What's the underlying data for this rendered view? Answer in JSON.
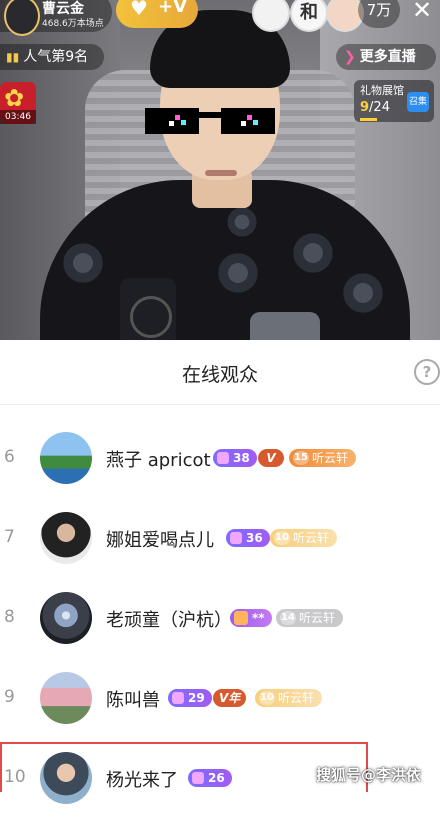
{
  "stream": {
    "host_name": "曹云金",
    "host_sub": "468.6万本场点",
    "follow_label": "+V",
    "viewer_avatar_labels": [
      "",
      "和",
      ""
    ],
    "viewer_count": "7万",
    "popularity_rank": "人气第9名",
    "more_live": "更多直播",
    "gift_timer": "03:46",
    "gift_gallery": {
      "title": "礼物展馆",
      "current": "9",
      "total": "/24",
      "progress": 0.375,
      "badge": "召集"
    }
  },
  "sheet": {
    "title": "在线观众",
    "help": "?"
  },
  "viewers": [
    {
      "rank": "6",
      "name": "燕子 apricot",
      "level": "38",
      "vip": "V",
      "fan_level": "15",
      "fan_club": "听云轩",
      "avatar_color": "#6fa8dc"
    },
    {
      "rank": "7",
      "name": "娜姐爱喝点儿",
      "level": "36",
      "fan_level": "10",
      "fan_club": "听云轩",
      "avatar_color": "#3b3b3b"
    },
    {
      "rank": "8",
      "name": "老顽童（沪杭）",
      "star_level": "**",
      "fan_level": "14",
      "fan_club": "听云轩",
      "avatar_color": "#2f3640"
    },
    {
      "rank": "9",
      "name": "陈叫兽",
      "level": "29",
      "vip": "V年",
      "fan_level": "10",
      "fan_club": "听云轩",
      "avatar_color": "#c99fa8"
    },
    {
      "rank": "10",
      "name": "杨光来了",
      "level": "26",
      "avatar_color": "#7d9cb8"
    }
  ],
  "watermark": "搜狐号@李洪依"
}
